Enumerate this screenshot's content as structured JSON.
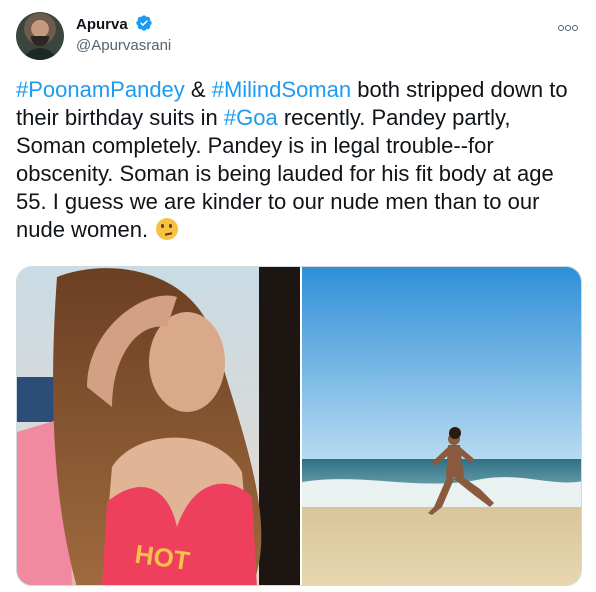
{
  "user": {
    "display_name": "Apurva",
    "handle": "@Apurvasrani",
    "verified": true,
    "avatar_icon": "avatar"
  },
  "tweet": {
    "parts": [
      {
        "text": "#PoonamPandey",
        "type": "hashtag"
      },
      {
        "text": " & ",
        "type": "text"
      },
      {
        "text": "#MilindSoman",
        "type": "hashtag"
      },
      {
        "text": " both stripped down to their birthday suits in ",
        "type": "text"
      },
      {
        "text": "#Goa",
        "type": "hashtag"
      },
      {
        "text": " recently. Pandey partly, Soman completely. Pandey is in legal trouble--for obscenity. Soman is being lauded for his fit body at age 55. I guess we are kinder to our nude men than to our nude women. ",
        "type": "text"
      }
    ],
    "emoji": "thinking-face-emoji"
  },
  "media": {
    "left_alt_text": "HOT",
    "count": 2
  },
  "colors": {
    "link": "#1d9bf0",
    "text": "#0f1419",
    "muted": "#536471",
    "verified": "#1d9bf0"
  }
}
